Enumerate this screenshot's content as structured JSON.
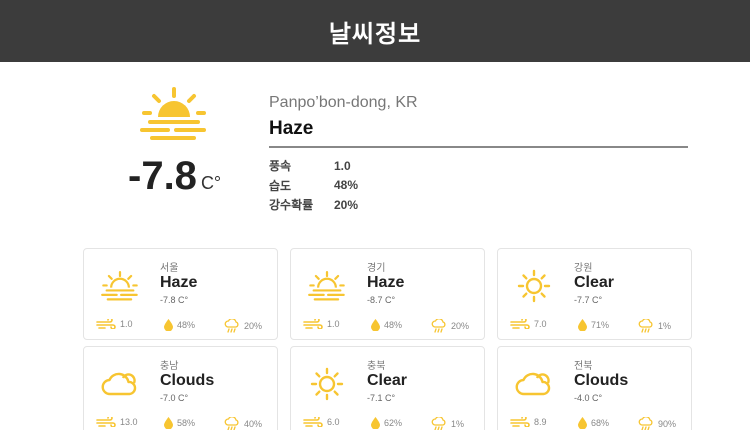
{
  "header": {
    "title": "날씨정보"
  },
  "current": {
    "icon": "haze-icon",
    "temp": "-7.8",
    "unit": "C°",
    "location": "Panpo’bon-dong, KR",
    "condition": "Haze",
    "stats": [
      {
        "label": "풍속",
        "value": "1.0"
      },
      {
        "label": "습도",
        "value": "48%"
      },
      {
        "label": "강수확률",
        "value": "20%"
      }
    ]
  },
  "regions": [
    {
      "region": "서울",
      "condition": "Haze",
      "icon": "haze-icon",
      "temp": "-7.8 C°",
      "wind": "1.0",
      "humidity": "48%",
      "rain": "20%"
    },
    {
      "region": "경기",
      "condition": "Haze",
      "icon": "haze-icon",
      "temp": "-8.7 C°",
      "wind": "1.0",
      "humidity": "48%",
      "rain": "20%"
    },
    {
      "region": "강원",
      "condition": "Clear",
      "icon": "sun-icon",
      "temp": "-7.7 C°",
      "wind": "7.0",
      "humidity": "71%",
      "rain": "1%"
    },
    {
      "region": "충남",
      "condition": "Clouds",
      "icon": "cloud-icon",
      "temp": "-7.0 C°",
      "wind": "13.0",
      "humidity": "58%",
      "rain": "40%"
    },
    {
      "region": "충북",
      "condition": "Clear",
      "icon": "sun-icon",
      "temp": "-7.1 C°",
      "wind": "6.0",
      "humidity": "62%",
      "rain": "1%"
    },
    {
      "region": "전북",
      "condition": "Clouds",
      "icon": "cloud-icon",
      "temp": "-4.0 C°",
      "wind": "8.9",
      "humidity": "68%",
      "rain": "90%"
    }
  ],
  "colors": {
    "accent": "#f7c531",
    "header_bg": "#3c3c3c"
  }
}
